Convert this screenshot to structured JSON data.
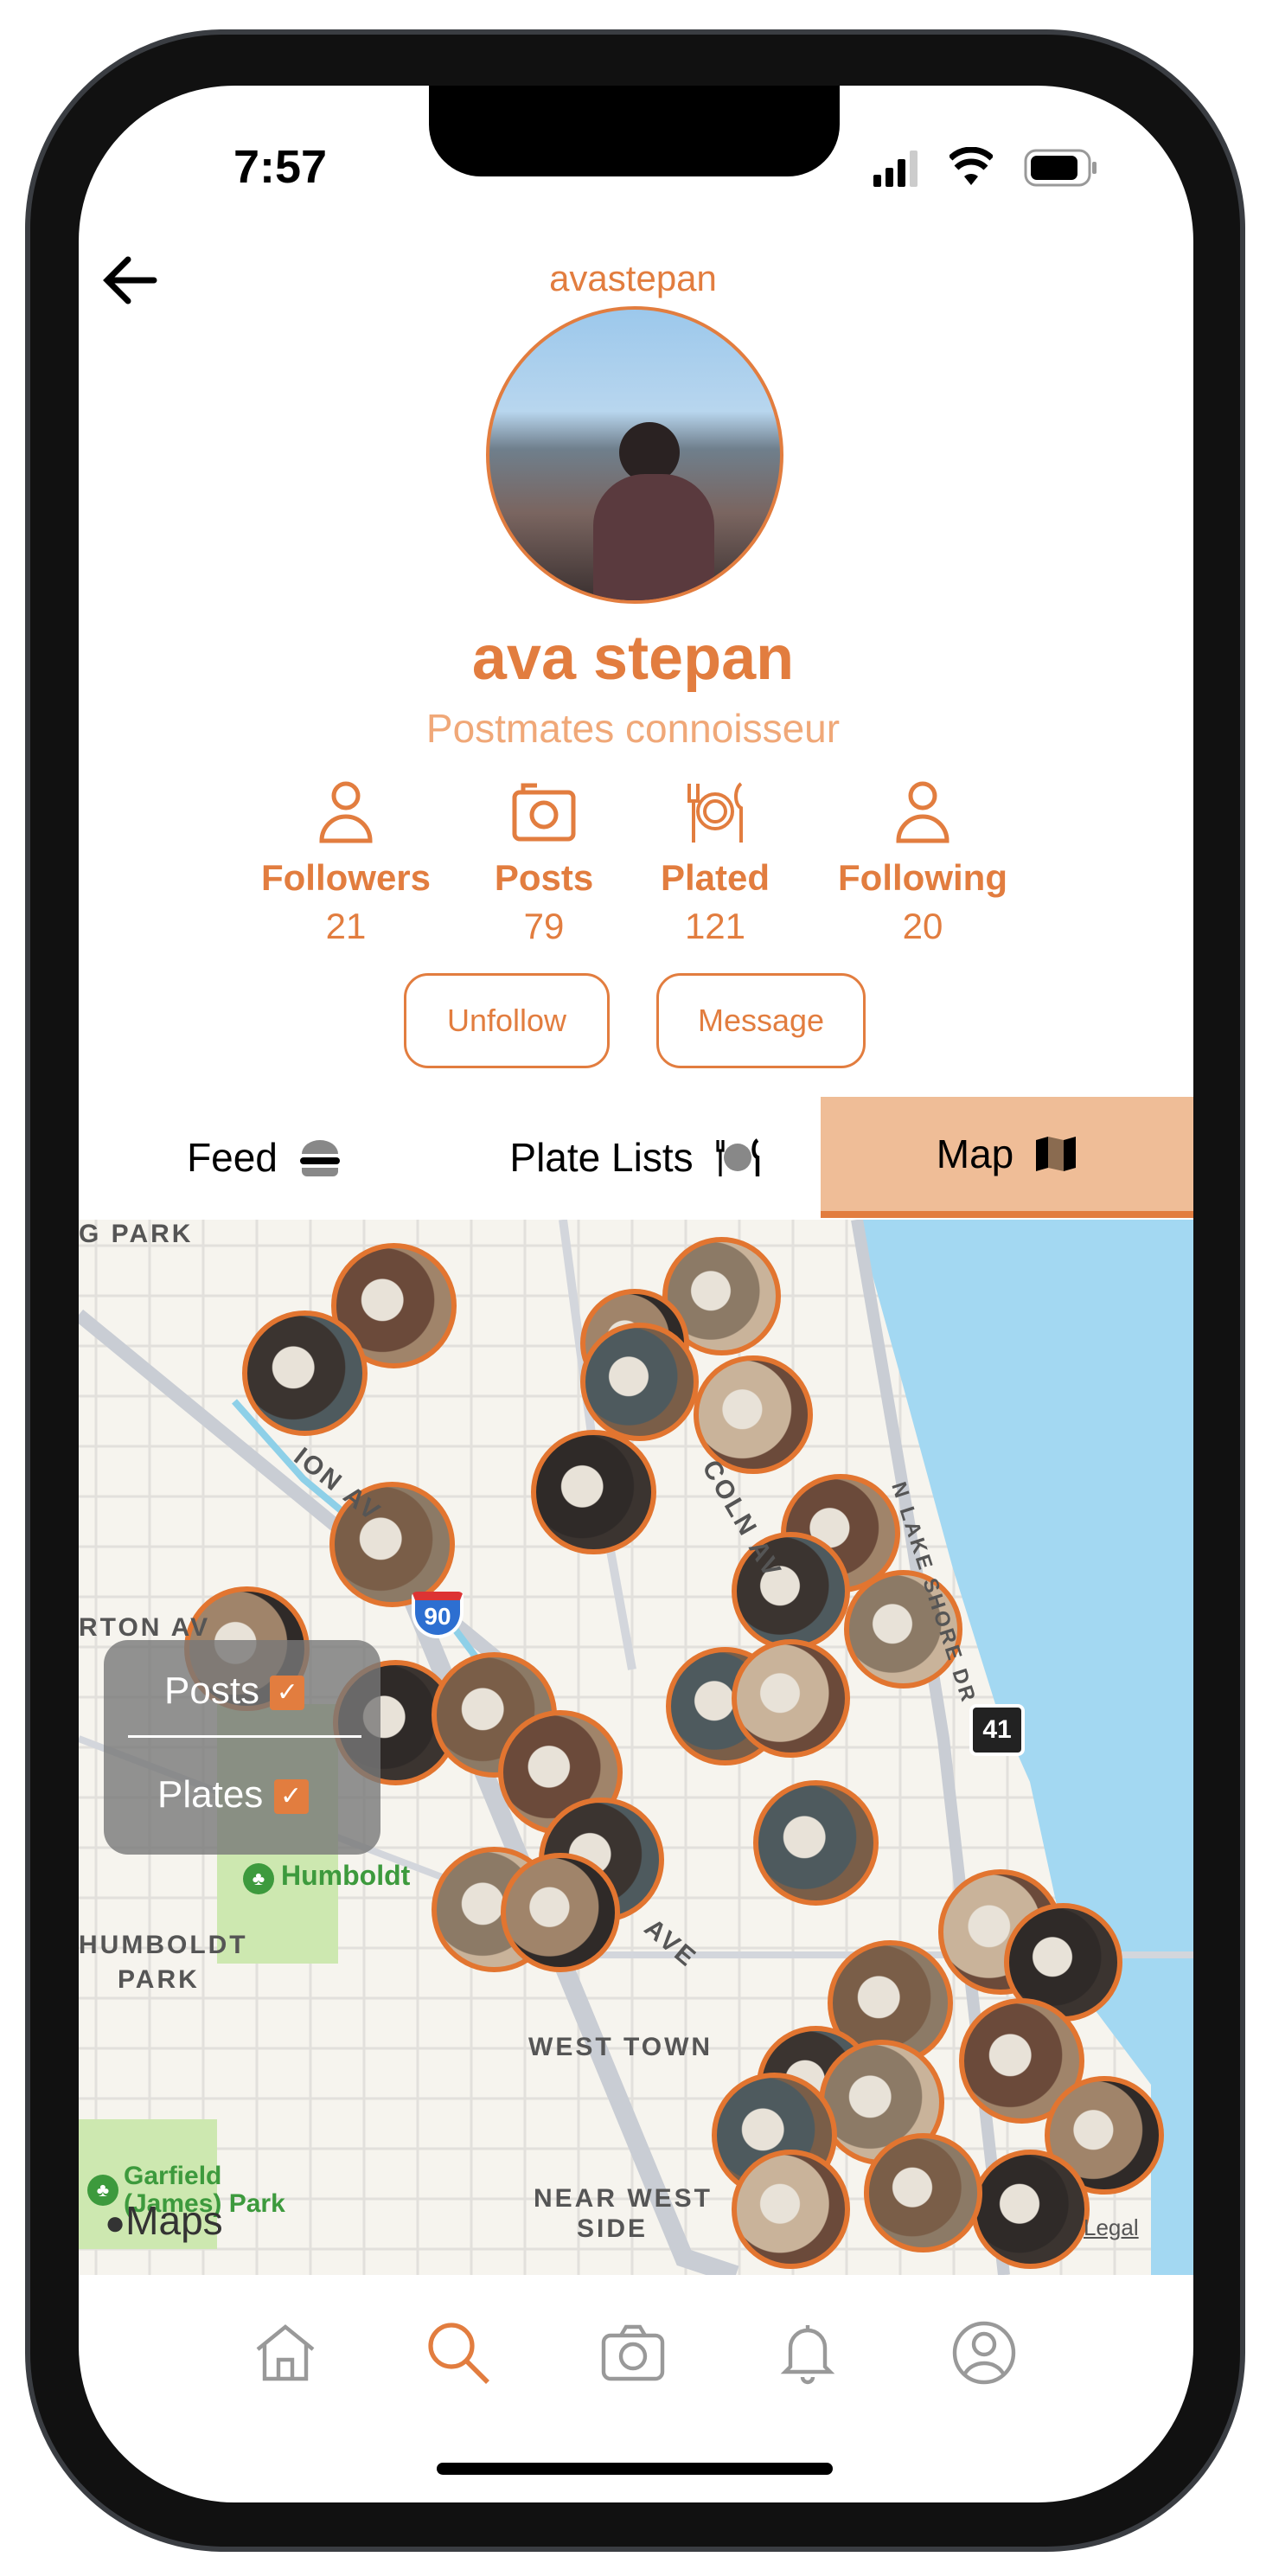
{
  "status": {
    "time": "7:57"
  },
  "profile": {
    "username": "avastepan",
    "name": "ava stepan",
    "bio": "Postmates connoisseur"
  },
  "stats": [
    {
      "label": "Followers",
      "value": "21",
      "icon": "person-icon"
    },
    {
      "label": "Posts",
      "value": "79",
      "icon": "camera-icon"
    },
    {
      "label": "Plated",
      "value": "121",
      "icon": "plate-utensils-icon"
    },
    {
      "label": "Following",
      "value": "20",
      "icon": "person-icon"
    }
  ],
  "actions": {
    "unfollow": "Unfollow",
    "message": "Message"
  },
  "tabs": [
    {
      "label": "Feed",
      "icon": "burger-icon"
    },
    {
      "label": "Plate Lists",
      "icon": "plate-utensils-icon"
    },
    {
      "label": "Map",
      "icon": "map-icon",
      "active": true
    }
  ],
  "map": {
    "labels": {
      "park_top": "G PARK",
      "avenue_left": "RTON AV",
      "ion_av": "ION AV",
      "lincoln": "COLN AV",
      "humboldt_poi": "Humboldt",
      "humboldt_park_1": "HUMBOLDT",
      "humboldt_park_2": "PARK",
      "west_town": "WEST TOWN",
      "near_west_1": "NEAR WEST",
      "near_west_2": "SIDE",
      "garfield_1": "Garfield",
      "garfield_2": "(James) Park",
      "ave": "AVE",
      "lake_shore": "N LAKE SHORE DR",
      "i90": "90",
      "us41": "41",
      "maps_brand": "Maps",
      "legal": "Legal"
    },
    "filters": [
      {
        "label": "Posts",
        "checked": true
      },
      {
        "label": "Plates",
        "checked": true
      }
    ]
  },
  "colors": {
    "accent": "#e27d3f",
    "tab_active_bg": "#efbd97",
    "water": "#a3d8f2",
    "park": "#cde8b0"
  },
  "bottom_nav": [
    {
      "icon": "home-icon"
    },
    {
      "icon": "search-icon",
      "active": true
    },
    {
      "icon": "camera-icon"
    },
    {
      "icon": "bell-icon"
    },
    {
      "icon": "profile-icon"
    }
  ]
}
